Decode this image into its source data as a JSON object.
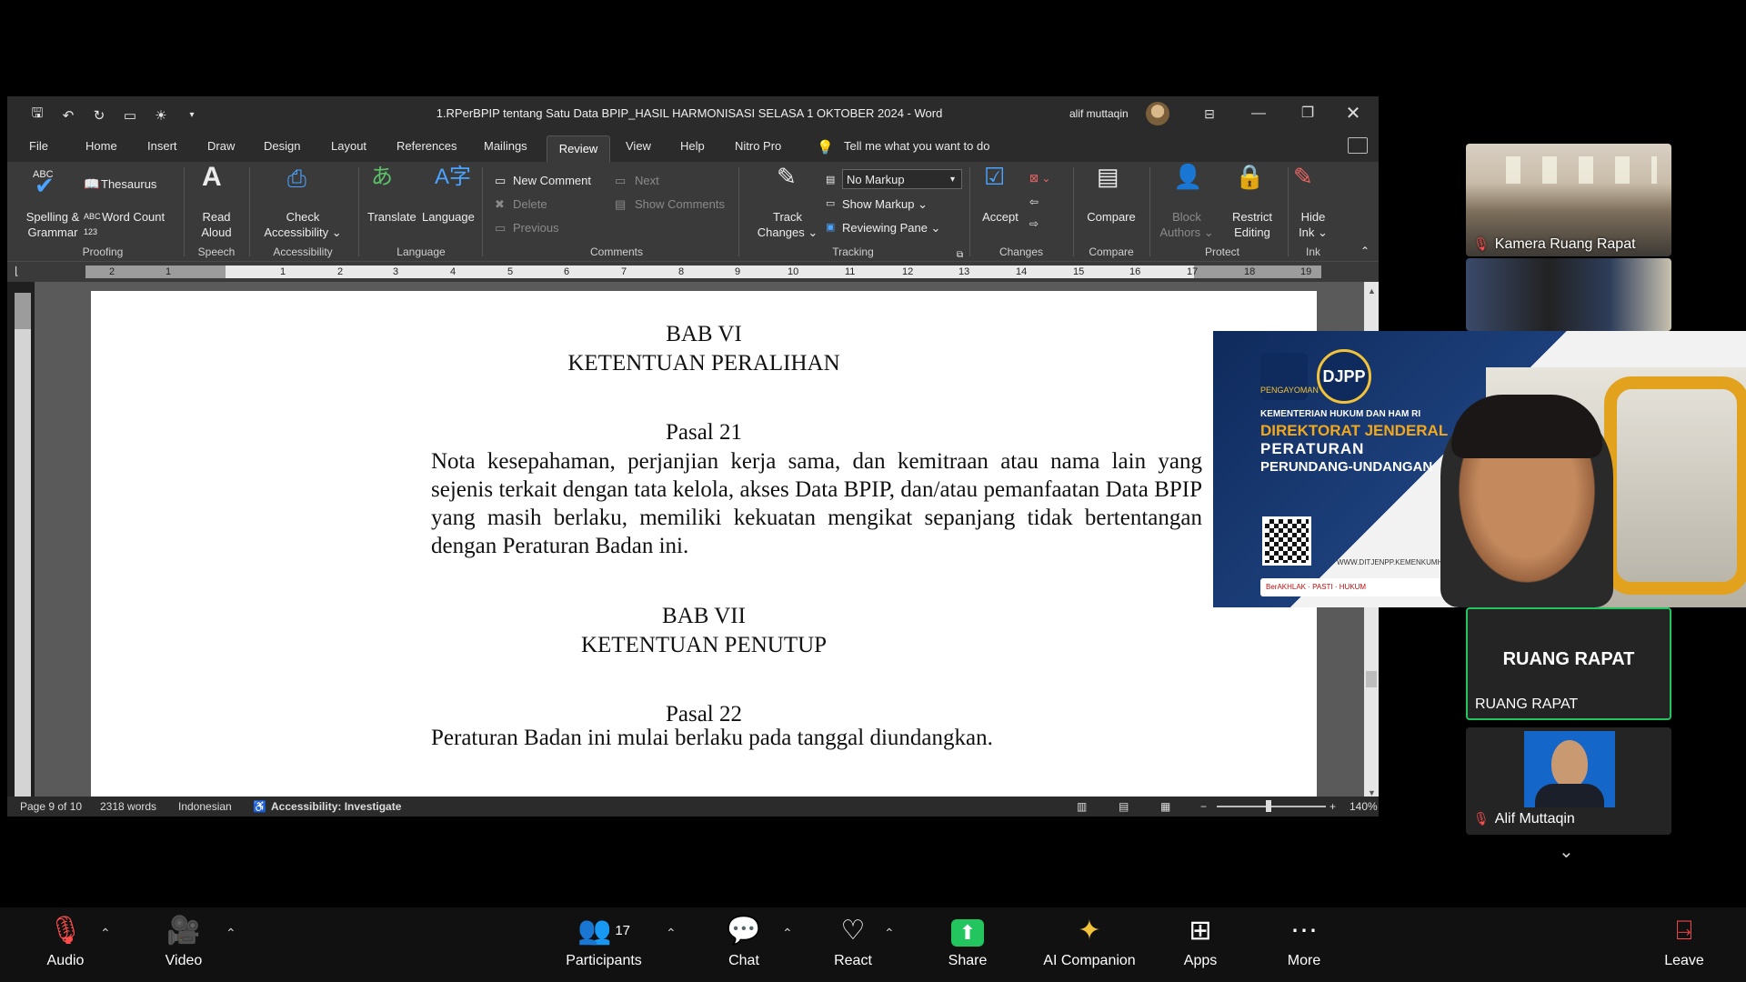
{
  "word": {
    "title": "1.RPerBPIP tentang Satu Data BPIP_HASIL HARMONISASI SELASA 1 OKTOBER 2024  -  Word",
    "user": "alif muttaqin",
    "menu": [
      "File",
      "Home",
      "Insert",
      "Draw",
      "Design",
      "Layout",
      "References",
      "Mailings",
      "Review",
      "View",
      "Help",
      "Nitro Pro"
    ],
    "tell_me": "Tell me what you want to do",
    "ribbon": {
      "spelling": "Spelling &\nGrammar",
      "abc": "ABC",
      "thesaurus": "Thesaurus",
      "word_count": "Word Count",
      "read_aloud": "Read\nAloud",
      "check_access": "Check\nAccessibility ⌄",
      "translate": "Translate",
      "language": "Language",
      "new_comment": "New Comment",
      "delete": "Delete",
      "previous": "Previous",
      "next": "Next",
      "show_comments": "Show Comments",
      "track_changes": "Track\nChanges ⌄",
      "no_markup": "No Markup",
      "show_markup": "Show Markup ⌄",
      "reviewing_pane": "Reviewing Pane ⌄",
      "accept": "Accept",
      "compare": "Compare",
      "block_authors": "Block\nAuthors ⌄",
      "restrict_editing": "Restrict\nEditing",
      "hide_ink": "Hide\nInk ⌄",
      "groups": [
        "Proofing",
        "Speech",
        "Accessibility",
        "Language",
        "Comments",
        "Tracking",
        "Changes",
        "Compare",
        "Protect",
        "Ink"
      ]
    },
    "ruler_ticks": [
      "2",
      "1",
      "1",
      "2",
      "3",
      "4",
      "5",
      "6",
      "7",
      "8",
      "9",
      "10",
      "11",
      "12",
      "13",
      "14",
      "15",
      "16",
      "17",
      "18",
      "19"
    ],
    "document": {
      "bab6": "BAB VI",
      "bab6_title": "KETENTUAN PERALIHAN",
      "pasal21": "Pasal 21",
      "pasal21_text": "Nota kesepahaman, perjanjian kerja sama, dan kemitraan atau nama lain yang sejenis terkait dengan tata kelola, akses Data BPIP, dan/atau pemanfaatan Data BPIP yang masih berlaku, memiliki kekuatan mengikat sepanjang tidak bertentangan dengan Peraturan Badan ini.",
      "bab7": "BAB VII",
      "bab7_title": "KETENTUAN PENUTUP",
      "pasal22": "Pasal 22",
      "pasal22_text": "Peraturan Badan ini mulai berlaku pada tanggal diundangkan."
    },
    "status": {
      "page": "Page 9 of 10",
      "words": "2318 words",
      "language": "Indonesian",
      "accessibility": "Accessibility: Investigate",
      "zoom": "140%"
    }
  },
  "participants": {
    "kamera": "Kamera Ruang Rapat",
    "ruang_name": "RUANG RAPAT",
    "ruang_label": "RUANG RAPAT",
    "alif": "Alif Muttaqin"
  },
  "shared_slide": {
    "logo1": "PENGAYOMAN",
    "logo2": "DJPP",
    "kementerian": "KEMENTERIAN HUKUM DAN HAM RI",
    "direktorat": "DIREKTORAT JENDERAL",
    "peraturan": "PERATURAN",
    "perundang": "PERUNDANG-UNDANGAN",
    "website": "WWW.DITJENPP.KEMENKUMHAM.GO",
    "footer": "BerAKHLAK  ·  PASTI  ·  HUKUM"
  },
  "toolbar": {
    "audio": "Audio",
    "video": "Video",
    "participants": "Participants",
    "participants_count": "17",
    "chat": "Chat",
    "react": "React",
    "share": "Share",
    "ai": "AI Companion",
    "apps": "Apps",
    "more": "More",
    "leave": "Leave"
  },
  "colors": {
    "accent_green": "#23c55e",
    "word_bg": "#2b2b2b",
    "mic_off": "#ff4d4d"
  }
}
